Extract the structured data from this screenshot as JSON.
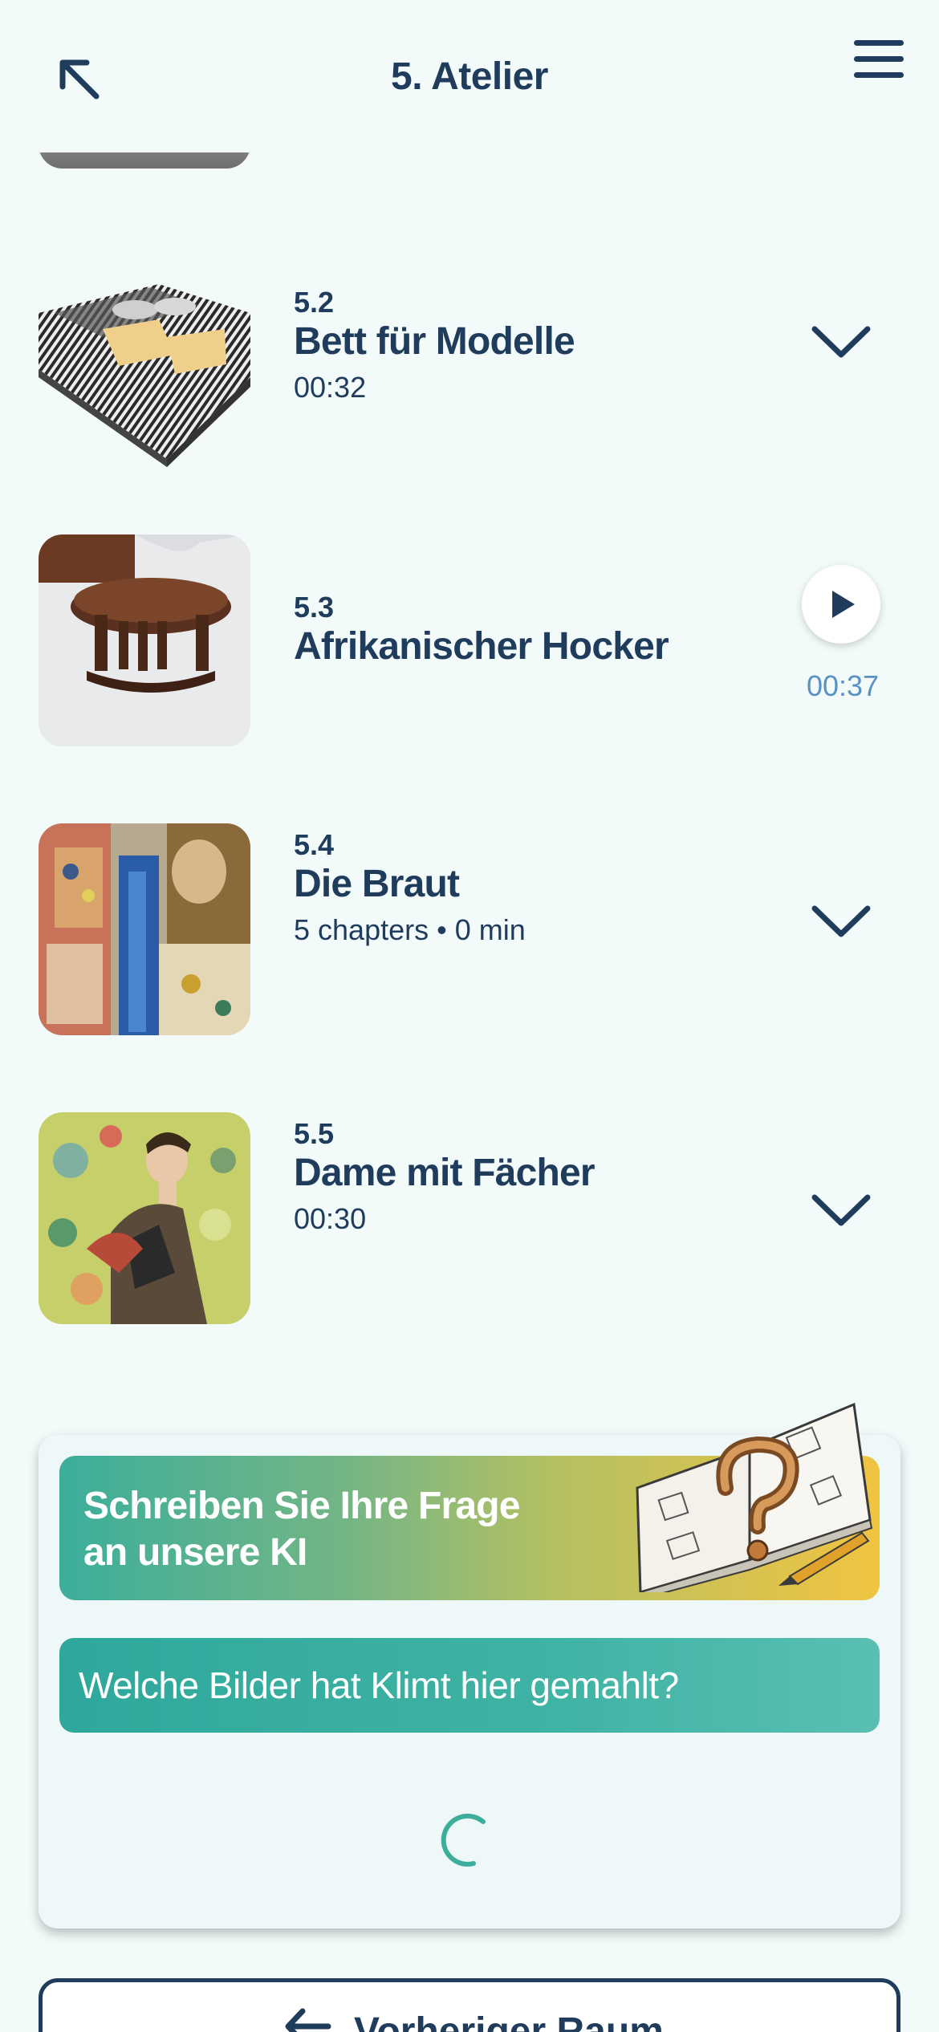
{
  "header": {
    "title": "5. Atelier"
  },
  "items": [
    {
      "number": "5.2",
      "title": "Bett für Modelle",
      "subtitle": "00:32",
      "action": "expand"
    },
    {
      "number": "5.3",
      "title": "Afrikanischer Hocker",
      "time": "00:37",
      "action": "play"
    },
    {
      "number": "5.4",
      "title": "Die Braut",
      "subtitle": "5 chapters • 0 min",
      "action": "expand"
    },
    {
      "number": "5.5",
      "title": "Dame mit Fächer",
      "subtitle": "00:30",
      "action": "expand"
    }
  ],
  "ai": {
    "banner_text": "Schreiben Sie Ihre Frage an unsere KI",
    "question": "Welche Bilder hat Klimt hier gemahlt?"
  },
  "footer": {
    "prev_room_label": "Vorheriger Raum"
  },
  "colors": {
    "navy": "#1f3c5c",
    "teal": "#3cae9b",
    "yellow": "#f0c441",
    "time_blue": "#5a92c3",
    "background": "#f3fafa"
  }
}
